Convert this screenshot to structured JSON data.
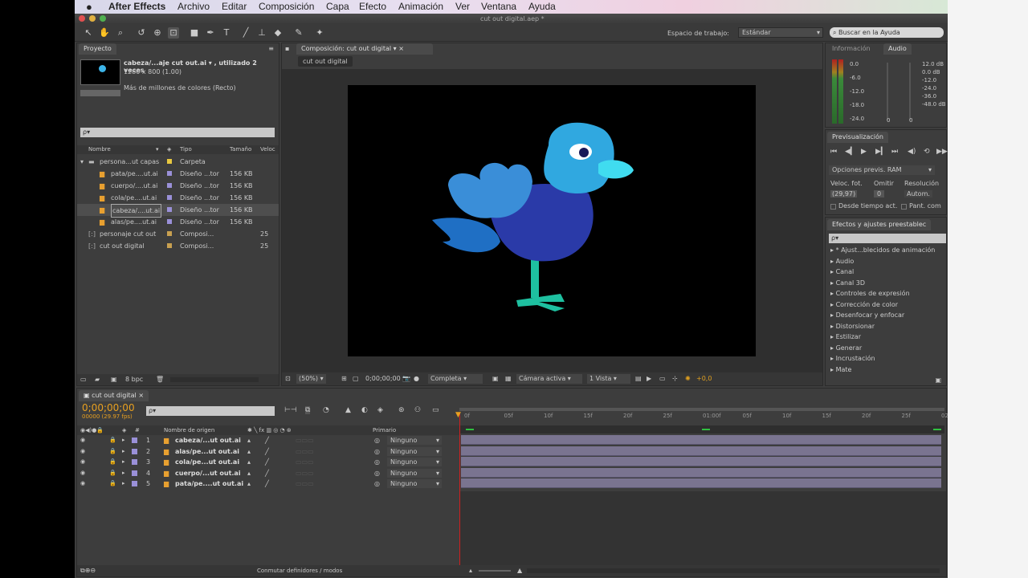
{
  "menubar": {
    "apple": "",
    "app": "After Effects",
    "items": [
      "Archivo",
      "Editar",
      "Composición",
      "Capa",
      "Efecto",
      "Animación",
      "Ver",
      "Ventana",
      "Ayuda"
    ]
  },
  "window": {
    "title": "cut out digital.aep *"
  },
  "toolbar": {
    "workspace_label": "Espacio de trabajo:",
    "workspace_value": "Estándar",
    "search_placeholder": "Buscar en la Ayuda"
  },
  "project": {
    "tab": "Proyecto",
    "selected_name": "cabeza/...aje cut out.ai ▾ , utilizado 2 veces",
    "dims": "1280 x 800 (1.00)",
    "colors": "Más de millones de colores (Recto)",
    "search_placeholder": "ρ▾",
    "col_name": "Nombre",
    "col_type": "Tipo",
    "col_size": "Tamaño",
    "col_speed": "Veloc",
    "rows": [
      {
        "name": "persona...ut capas",
        "type": "Carpeta",
        "size": "",
        "extra": "",
        "color": "#e8c840"
      },
      {
        "name": "pata/pe....ut.ai",
        "type": "Diseño ...tor",
        "size": "156 KB",
        "extra": "",
        "color": "#9a90d8"
      },
      {
        "name": "cuerpo/....ut.ai",
        "type": "Diseño ...tor",
        "size": "156 KB",
        "extra": "",
        "color": "#9a90d8"
      },
      {
        "name": "cola/pe....ut.ai",
        "type": "Diseño ...tor",
        "size": "156 KB",
        "extra": "",
        "color": "#9a90d8"
      },
      {
        "name": "cabeza/....ut.ai",
        "type": "Diseño ...tor",
        "size": "156 KB",
        "extra": "",
        "color": "#9a90d8"
      },
      {
        "name": "alas/pe....ut.ai",
        "type": "Diseño ...tor",
        "size": "156 KB",
        "extra": "",
        "color": "#9a90d8"
      },
      {
        "name": "personaje cut out",
        "type": "Composi...",
        "size": "",
        "extra": "25",
        "color": "#c8a050"
      },
      {
        "name": "cut out digital",
        "type": "Composi...",
        "size": "",
        "extra": "25",
        "color": "#c8a050"
      }
    ],
    "bpc": "8 bpc"
  },
  "composition": {
    "tab": "Composición: cut out digital",
    "subtab": "cut out digital",
    "zoom": "(50%)",
    "timecode": "0;00;00;00",
    "resolution": "Completa",
    "camera": "Cámara activa",
    "views": "1 Vista",
    "exposure": "+0,0"
  },
  "info": {
    "tab_info": "Información",
    "tab_audio": "Audio",
    "left_scale": [
      "0.0",
      "-6.0",
      "-12.0",
      "-18.0",
      "-24.0"
    ],
    "right_scale": [
      "12.0 dB",
      "0.0 dB",
      "-12.0",
      "-24.0",
      "-36.0",
      "-48.0 dB"
    ],
    "zeros": [
      "0",
      "0"
    ]
  },
  "preview": {
    "tab": "Previsualización",
    "options": "Opciones previs. RAM",
    "fps_label": "Veloc. fot.",
    "skip_label": "Omitir",
    "res_label": "Resolución",
    "fps": "(29,97)",
    "skip": "0",
    "res": "Autom.",
    "from_current": "Desde tiempo act.",
    "fullscreen": "Pant. com"
  },
  "effects": {
    "tab": "Efectos y ajustes preestablec",
    "search_placeholder": "ρ▾",
    "items": [
      "* Ajust...blecidos de animación",
      "Audio",
      "Canal",
      "Canal 3D",
      "Controles de expresión",
      "Corrección de color",
      "Desenfocar y enfocar",
      "Distorsionar",
      "Estilizar",
      "Generar",
      "Incrustación",
      "Mate"
    ]
  },
  "timeline": {
    "tab": "cut out digital",
    "timecode": "0;00;00;00",
    "frames": "00000 (29.97 fps)",
    "search_placeholder": "ρ▾",
    "col_source": "Nombre de origen",
    "col_parent": "Primario",
    "ruler": [
      "0f",
      "05f",
      "10f",
      "15f",
      "20f",
      "25f",
      "01:00f",
      "05f",
      "10f",
      "15f",
      "20f",
      "25f",
      "02"
    ],
    "layers": [
      {
        "num": "1",
        "name": "cabeza/...ut out.ai",
        "parent": "Ninguno"
      },
      {
        "num": "2",
        "name": "alas/pe...ut out.ai",
        "parent": "Ninguno"
      },
      {
        "num": "3",
        "name": "cola/pe...ut out.ai",
        "parent": "Ninguno"
      },
      {
        "num": "4",
        "name": "cuerpo/...ut out.ai",
        "parent": "Ninguno"
      },
      {
        "num": "5",
        "name": "pata/pe....ut out.ai",
        "parent": "Ninguno"
      }
    ],
    "toggle": "Conmutar definidores / modos"
  }
}
